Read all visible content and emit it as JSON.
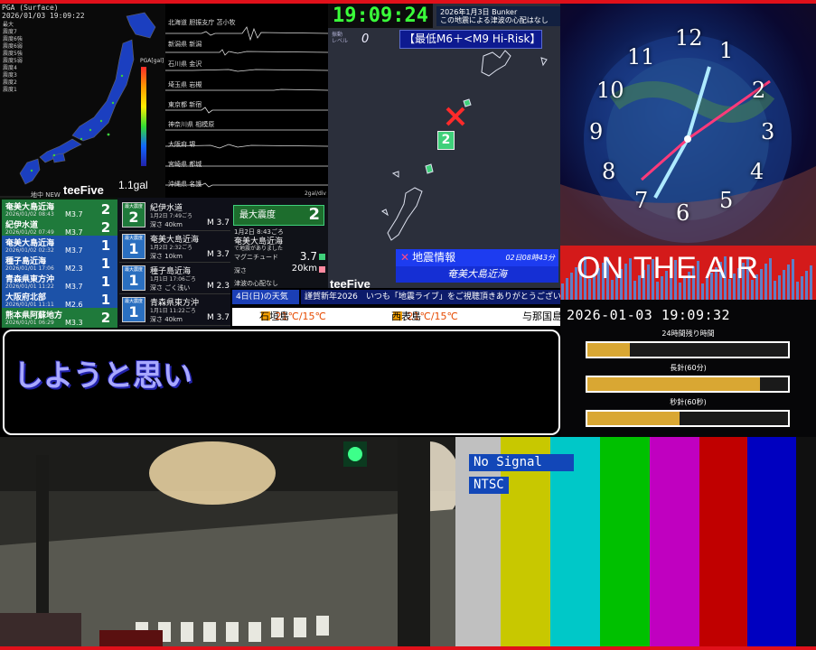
{
  "pga": {
    "header_line1": "PGA (Surface)",
    "header_line2": "2026/01/03 19:09:22",
    "legend": [
      "最大",
      "震度7",
      "震度6強",
      "震度6弱",
      "震度5強",
      "震度5弱",
      "震度4",
      "震度3",
      "震度2",
      "震度1"
    ],
    "scale_label": "PGA[gal]",
    "value": "1.1gal",
    "footer": "地中 NEW"
  },
  "seismo": {
    "stations": [
      "北海道 胆振支庁 苫小牧",
      "新潟県 新潟",
      "石川県 金沢",
      "埼玉県 岩槻",
      "東京都 新宿",
      "神奈川県 相模原",
      "大阪府 堺",
      "宮崎県 都城",
      "沖縄県 名護"
    ],
    "unit": "2gal/div",
    "brand": "teeFive"
  },
  "quake_map": {
    "clock": "19:09:24",
    "info_line1": "2026年1月3日 Bunker",
    "info_line2": "この地震による津波の心配はなし",
    "level_label": "振動\nレベル",
    "level_value": "0",
    "risk_label": "【最低M6＋<M9 Hi-Risk】",
    "intensity": "2",
    "brand": "teeFive",
    "eq_title": "地震情報",
    "eq_time": "02日08時43分",
    "eq_place": "奄美大島近海"
  },
  "clock_art": {
    "numbers": [
      "12",
      "1",
      "2",
      "3",
      "4",
      "5",
      "6",
      "7",
      "8",
      "9",
      "10",
      "11"
    ]
  },
  "on_air": {
    "title": "ON THE AIR",
    "datetime": "2026-01-03 19:09:32",
    "bars": [
      {
        "label": "24時間残り時間",
        "progress": 0.21
      },
      {
        "label": "長針(60分)",
        "progress": 0.86
      },
      {
        "label": "秒針(60秒)",
        "progress": 0.46
      }
    ]
  },
  "subtitle": {
    "text": "しようと思い"
  },
  "eq_list": [
    {
      "place": "奄美大島近海",
      "datetime": "2026/01/02 08:43",
      "mag": "M3.7",
      "intensity": "2",
      "color": "#1f7a3b"
    },
    {
      "place": "紀伊水道",
      "datetime": "2026/01/02 07:49",
      "mag": "M3.7",
      "intensity": "2",
      "color": "#1f7a3b"
    },
    {
      "place": "奄美大島近海",
      "datetime": "2026/01/02 02:32",
      "mag": "M3.7",
      "intensity": "1",
      "color": "#1c52a8"
    },
    {
      "place": "種子島近海",
      "datetime": "2026/01/01 17:06",
      "mag": "M2.3",
      "intensity": "1",
      "color": "#1c52a8"
    },
    {
      "place": "青森県東方沖",
      "datetime": "2026/01/01 11:22",
      "mag": "M3.7",
      "intensity": "1",
      "color": "#1c52a8"
    },
    {
      "place": "大阪府北部",
      "datetime": "2026/01/01 11:11",
      "mag": "M2.6",
      "intensity": "1",
      "color": "#1c52a8"
    },
    {
      "place": "熊本県阿蘇地方",
      "datetime": "2026/01/01 06:29",
      "mag": "M3.3",
      "intensity": "2",
      "color": "#1f7a3b"
    }
  ],
  "eq_detail": [
    {
      "badge_label": "最大震度",
      "intensity": "2",
      "name": "紀伊水道",
      "time": "1月2日 7:49ごろ",
      "depth": "深さ 40km",
      "mag": "M 3.7"
    },
    {
      "badge_label": "最大震度",
      "intensity": "1",
      "name": "奄美大島近海",
      "time": "1月2日 2:32ごろ",
      "depth": "深さ 10km",
      "mag": "M 3.7"
    },
    {
      "badge_label": "最大震度",
      "intensity": "1",
      "name": "種子島近海",
      "time": "1月1日 17:06ごろ",
      "depth": "深さ ごく浅い",
      "mag": "M 2.3"
    },
    {
      "badge_label": "最大震度",
      "intensity": "1",
      "name": "青森県東方沖",
      "time": "1月1日 11:22ごろ",
      "depth": "深さ 40km",
      "mag": "M 3.7"
    }
  ],
  "max_int": {
    "label": "最大震度",
    "value": "2",
    "time": "1月2日 8:43ごろ",
    "place": "奄美大島近海",
    "sub": "で地震がありました",
    "mag_label": "マグニチュード",
    "mag_value": "3.7",
    "depth_label": "深さ",
    "depth_value": "20km",
    "tsunami": "津波の心配なし"
  },
  "weather": {
    "title": "4日(日)の天気",
    "ticker": "謹賀新年2026　いつも「地震ライブ」をご視聴頂きありがとうございます!",
    "cities": [
      {
        "name": "石垣島",
        "temp": "21℃/15℃"
      },
      {
        "name": "西表島",
        "temp": "21℃/15℃"
      },
      {
        "name": "与那国島",
        "temp": ""
      }
    ]
  },
  "test_card": {
    "signal": "No Signal",
    "standard": "NTSC",
    "colors": [
      "#c0c0c0",
      "#c8c800",
      "#00c8c8",
      "#00c000",
      "#c000c0",
      "#c00000",
      "#0000c0",
      "#101010"
    ]
  }
}
